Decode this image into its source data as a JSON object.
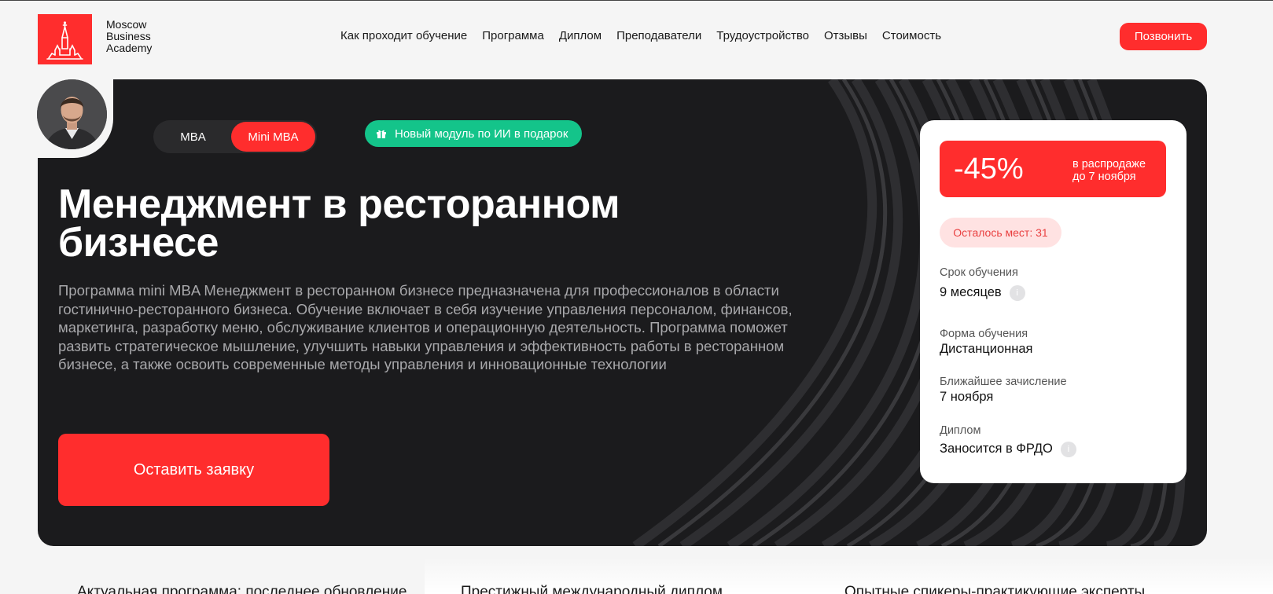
{
  "logo": {
    "line1": "Moscow",
    "line2": "Business",
    "line3": "Academy"
  },
  "nav": {
    "items": [
      "Как проходит обучение",
      "Программа",
      "Диплом",
      "Преподаватели",
      "Трудоустройство",
      "Отзывы",
      "Стоимость"
    ]
  },
  "header": {
    "call_label": "Позвонить"
  },
  "hero": {
    "switch": {
      "mba": "MBA",
      "mini": "Mini MBA",
      "selected": "Mini MBA"
    },
    "gift_label": "Новый модуль по ИИ в подарок",
    "title_line1": "Менеджмент в ресторанном",
    "title_line2": "бизнесе",
    "description": "Программа mini MBA Менеджмент в ресторанном бизнесе предназначена для профессионалов в области гостинично-ресторанного бизнеса. Обучение включает в себя изучение управления персоналом, финансов, маркетинга, разработку меню, обслуживание клиентов и операционную деятельность. Программа поможет развить стратегическое мышление, улучшить навыки управления и эффективность работы в ресторанном бизнесе, а также освоить современные методы управления и инновационные технологии",
    "apply_label": "Оставить заявку"
  },
  "card": {
    "discount": "-45%",
    "sale_line1": "в распродаже",
    "sale_line2": "до 7 ноября",
    "seats": "Осталось мест: 31",
    "duration_label": "Срок обучения",
    "duration_value": "9 месяцев",
    "form_label": "Форма обучения",
    "form_value": "Дистанционная",
    "enroll_label": "Ближайшее зачисление",
    "enroll_value": "7 ноября",
    "diploma_label": "Диплом",
    "diploma_value": "Заносится в ФРДО"
  },
  "features": {
    "f1": "Актуальная программа: последнее обновление",
    "f2": "Престижный международный диплом",
    "f3": "Опытные спикеры-практикующие эксперты"
  },
  "colors": {
    "accent": "#ff2d2d",
    "dark": "#1b1b1d",
    "green": "#14c48a"
  }
}
